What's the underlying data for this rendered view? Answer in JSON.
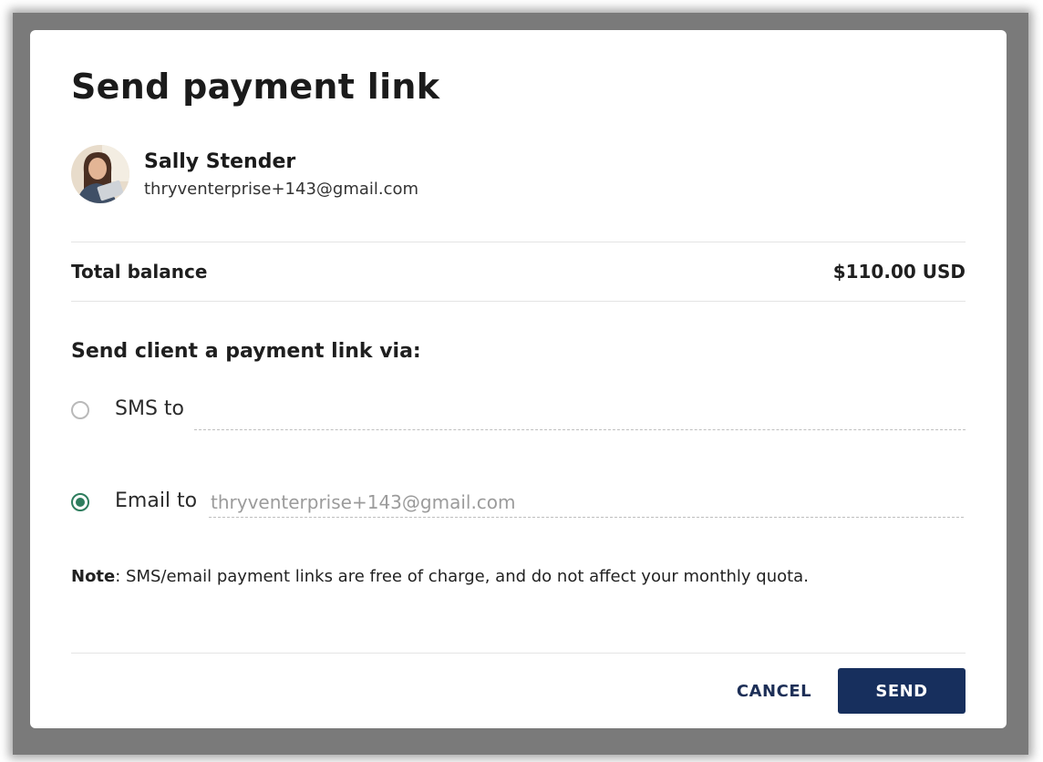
{
  "dialog": {
    "title": "Send payment link"
  },
  "customer": {
    "name": "Sally Stender",
    "email": "thryventerprise+143@gmail.com"
  },
  "balance": {
    "label": "Total balance",
    "value": "$110.00 USD"
  },
  "delivery": {
    "heading": "Send client a payment link via:",
    "sms": {
      "label": "SMS to",
      "value": "",
      "selected": false
    },
    "email": {
      "label": "Email to",
      "value": "thryventerprise+143@gmail.com",
      "selected": true
    }
  },
  "note": {
    "prefix": "Note",
    "text": ": SMS/email payment links are free of charge, and do not affect your monthly quota."
  },
  "actions": {
    "cancel_label": "CANCEL",
    "send_label": "SEND"
  },
  "colors": {
    "primary": "#172f5d",
    "radio_selected": "#2e7d5e"
  }
}
